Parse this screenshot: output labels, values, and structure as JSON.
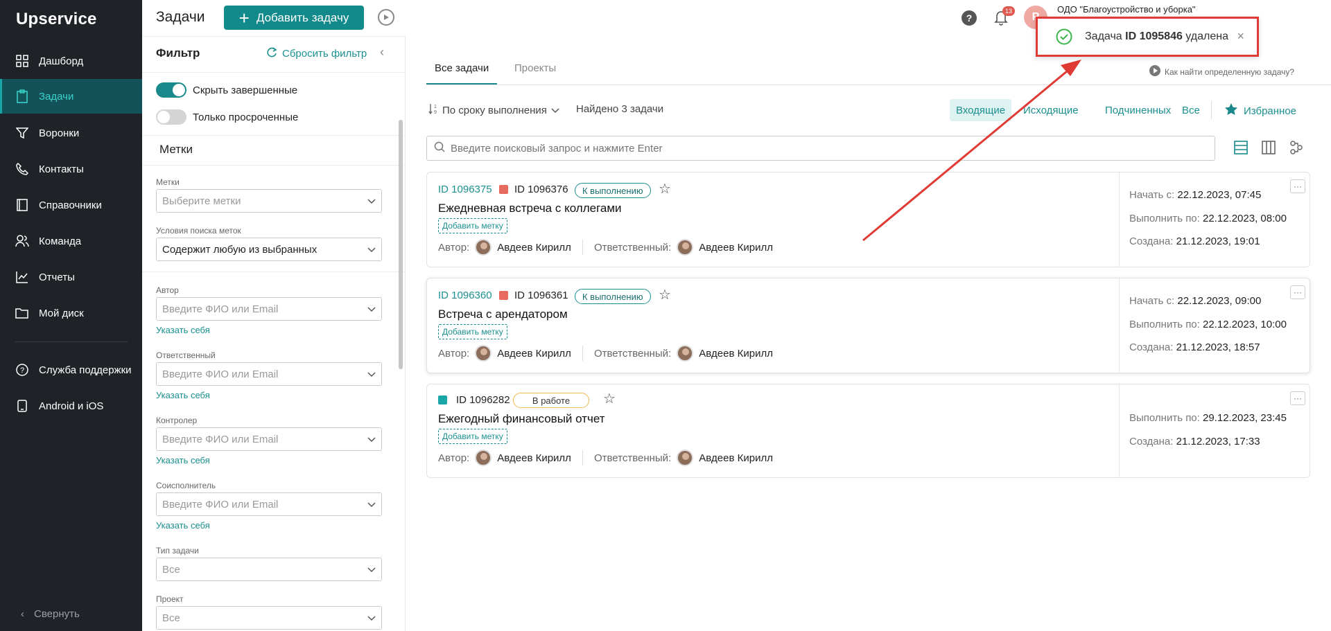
{
  "app": {
    "logo": "Upservice"
  },
  "sidebar": {
    "items": [
      {
        "label": "Дашборд",
        "icon": "grid-icon"
      },
      {
        "label": "Задачи",
        "icon": "clipboard-icon"
      },
      {
        "label": "Воронки",
        "icon": "funnel-icon"
      },
      {
        "label": "Контакты",
        "icon": "phone-icon"
      },
      {
        "label": "Справочники",
        "icon": "book-icon"
      },
      {
        "label": "Команда",
        "icon": "team-icon"
      },
      {
        "label": "Отчеты",
        "icon": "chart-icon"
      },
      {
        "label": "Мой диск",
        "icon": "folder-icon"
      },
      {
        "label": "Служба поддержки",
        "icon": "help-icon"
      },
      {
        "label": "Android и iOS",
        "icon": "phone-device-icon"
      }
    ],
    "collapse": "Свернуть"
  },
  "header": {
    "title": "Задачи",
    "add_button": "Добавить задачу",
    "notifications_count": "13",
    "org_name": "ОДО \"Благоустройство и уборка\"",
    "avatar_letter": "Р"
  },
  "filter": {
    "title": "Фильтр",
    "reset": "Сбросить фильтр",
    "toggle_hide_done": "Скрыть завершенные",
    "toggle_overdue": "Только просроченные",
    "labels_section": "Метки",
    "fields": [
      {
        "label": "Метки",
        "value": "Выберите метки"
      },
      {
        "label": "Условия поиска меток",
        "value": "Содержит любую из выбранных"
      },
      {
        "label": "Автор",
        "value": "Введите ФИО или Email",
        "link": "Указать себя"
      },
      {
        "label": "Ответственный",
        "value": "Введите ФИО или Email",
        "link": "Указать себя"
      },
      {
        "label": "Контролер",
        "value": "Введите ФИО или Email",
        "link": "Указать себя"
      },
      {
        "label": "Соисполнитель",
        "value": "Введите ФИО или Email",
        "link": "Указать себя"
      },
      {
        "label": "Тип задачи",
        "value": "Все"
      },
      {
        "label": "Проект",
        "value": "Все"
      }
    ]
  },
  "main": {
    "tabs": [
      "Все задачи",
      "Проекты"
    ],
    "howto": "Как найти определенную задачу?",
    "sort": "По сроку выполнения",
    "found": "Найдено 3 задачи",
    "scopes": [
      "Входящие",
      "Исходящие",
      "Подчиненных",
      "Все"
    ],
    "favorites": "Избранное",
    "search_placeholder": "Введите поисковый запрос и нажмите Enter",
    "add_tag": "Добавить метку",
    "author_label": "Автор:",
    "assignee_label": "Ответственный:",
    "start_label": "Начать с:",
    "due_label": "Выполнить по:",
    "created_label": "Создана:",
    "tasks": [
      {
        "parent_id": "ID 1096375",
        "id": "ID 1096376",
        "status": "К выполнению",
        "title": "Ежедневная встреча с коллегами",
        "author": "Авдеев Кирилл",
        "assignee": "Авдеев Кирилл",
        "start": "22.12.2023, 07:45",
        "due": "22.12.2023, 08:00",
        "created": "21.12.2023, 19:01"
      },
      {
        "parent_id": "ID 1096360",
        "id": "ID 1096361",
        "status": "К выполнению",
        "title": "Встреча с арендатором",
        "author": "Авдеев Кирилл",
        "assignee": "Авдеев Кирилл",
        "start": "22.12.2023, 09:00",
        "due": "22.12.2023, 10:00",
        "created": "21.12.2023, 18:57"
      },
      {
        "id": "ID 1096282",
        "status": "В работе",
        "title": "Ежегодный финансовый отчет",
        "author": "Авдеев Кирилл",
        "assignee": "Авдеев Кирилл",
        "due": "29.12.2023, 23:45",
        "created": "21.12.2023, 17:33"
      }
    ]
  },
  "toast": {
    "prefix": "Задача ",
    "id": "ID 1095846",
    "suffix": " удалена"
  },
  "colors": {
    "accent": "#128a8c",
    "sidebar_bg": "#1f2327",
    "annotation": "#e03a34",
    "status_work": "#f0b94b"
  }
}
